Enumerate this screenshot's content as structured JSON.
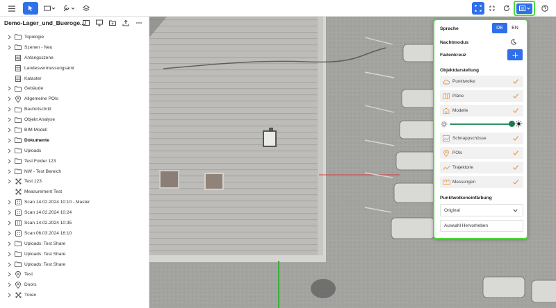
{
  "toolbar": {
    "left_buttons": [
      "menu-icon",
      "pointer-icon",
      "shape-select-icon",
      "tools-icon",
      "layers-icon"
    ],
    "right_buttons": [
      "fit-view-icon",
      "expand-icon",
      "rotate-icon",
      "settings-panel-icon",
      "help-icon"
    ],
    "accent_color": "#2f6fea",
    "highlight_color": "#4ddb3a"
  },
  "sidebar": {
    "title": "Demo-Lager_und_Bueroge...",
    "header_icons": [
      "layout-icon",
      "monitor-icon",
      "folder-add-icon",
      "upload-icon",
      "more-icon"
    ],
    "items": [
      {
        "label": "Topologie",
        "icon": "folder-icon",
        "chevron": true,
        "indent": 0,
        "bold": false
      },
      {
        "label": "Szenen - Neu",
        "icon": "folder-icon",
        "chevron": true,
        "indent": 0,
        "bold": false
      },
      {
        "label": "Anfangsszene",
        "icon": "scene-icon",
        "chevron": false,
        "indent": 1,
        "bold": false
      },
      {
        "label": "Landesvermessungsamt",
        "icon": "scene-icon",
        "chevron": false,
        "indent": 1,
        "bold": false
      },
      {
        "label": "Kataster",
        "icon": "scene-icon",
        "chevron": false,
        "indent": 1,
        "bold": false
      },
      {
        "label": "Gebäude",
        "icon": "folder-icon",
        "chevron": true,
        "indent": 0,
        "bold": false
      },
      {
        "label": "Allgemeine POIs",
        "icon": "pin-icon",
        "chevron": true,
        "indent": 0,
        "bold": false
      },
      {
        "label": "Baufortschritt",
        "icon": "folder-icon",
        "chevron": true,
        "indent": 0,
        "bold": false
      },
      {
        "label": "Objekt Analyse",
        "icon": "folder-icon",
        "chevron": true,
        "indent": 0,
        "bold": false
      },
      {
        "label": "BIM Modell",
        "icon": "folder-icon",
        "chevron": true,
        "indent": 0,
        "bold": false
      },
      {
        "label": "Dokumente",
        "icon": "folder-icon",
        "chevron": true,
        "indent": 0,
        "bold": true
      },
      {
        "label": "Uploads",
        "icon": "folder-icon",
        "chevron": true,
        "indent": 0,
        "bold": false
      },
      {
        "label": "Test Folder 123",
        "icon": "folder-icon",
        "chevron": true,
        "indent": 0,
        "bold": false
      },
      {
        "label": "NW - Test Bereich",
        "icon": "folder-icon",
        "chevron": true,
        "indent": 0,
        "bold": false
      },
      {
        "label": "Test 123",
        "icon": "measure-icon",
        "chevron": true,
        "indent": 0,
        "bold": false
      },
      {
        "label": "Measurement Test",
        "icon": "measure-icon",
        "chevron": false,
        "indent": 0,
        "bold": false
      },
      {
        "label": "Scan 14.02.2024 10:10 - Master",
        "icon": "scan-icon",
        "chevron": true,
        "indent": 0,
        "bold": false
      },
      {
        "label": "Scan 14.02.2024 10:24",
        "icon": "scan-icon",
        "chevron": true,
        "indent": 0,
        "bold": false
      },
      {
        "label": "Scan 14.02.2024 10:35",
        "icon": "scan-icon",
        "chevron": true,
        "indent": 0,
        "bold": false
      },
      {
        "label": "Scan 06.03.2024 16:10",
        "icon": "scan-icon",
        "chevron": true,
        "indent": 0,
        "bold": false
      },
      {
        "label": "Uploads: Test Share",
        "icon": "folder-icon",
        "chevron": true,
        "indent": 0,
        "bold": false
      },
      {
        "label": "Uploads: Test Share",
        "icon": "folder-icon",
        "chevron": true,
        "indent": 0,
        "bold": false
      },
      {
        "label": "Uploads: Test Share",
        "icon": "folder-icon",
        "chevron": true,
        "indent": 0,
        "bold": false
      },
      {
        "label": "Test",
        "icon": "pin-icon",
        "chevron": true,
        "indent": 0,
        "bold": false
      },
      {
        "label": "Doors",
        "icon": "pin-icon",
        "chevron": true,
        "indent": 0,
        "bold": false
      },
      {
        "label": "Türen",
        "icon": "measure-icon",
        "chevron": true,
        "indent": 0,
        "bold": false
      }
    ]
  },
  "panel": {
    "language_label": "Sprache",
    "lang_de": "DE",
    "lang_en": "EN",
    "lang_selected": "DE",
    "night_mode_label": "Nachtmodus",
    "crosshair_label": "Fadenkreuz",
    "crosshair_enabled": true,
    "object_section_title": "Objektdarstellung",
    "objects": [
      {
        "label": "Punktwolke",
        "icon": "cloud-icon",
        "checked": true
      },
      {
        "label": "Pläne",
        "icon": "map-icon",
        "checked": true
      },
      {
        "label": "Modelle",
        "icon": "building-icon",
        "checked": true
      }
    ],
    "brightness_level": 1.0,
    "objects2": [
      {
        "label": "Schnappschüsse",
        "icon": "image-icon",
        "checked": true
      },
      {
        "label": "POIs",
        "icon": "pin-icon",
        "checked": true
      },
      {
        "label": "Trajektorie",
        "icon": "trajectory-icon",
        "checked": true
      },
      {
        "label": "Messungen",
        "icon": "ruler-icon",
        "checked": true
      }
    ],
    "coloring_title": "Punktwolkeneinfärbung",
    "coloring_value": "Original",
    "highlight_button": "Auswahl Hervorheben"
  }
}
